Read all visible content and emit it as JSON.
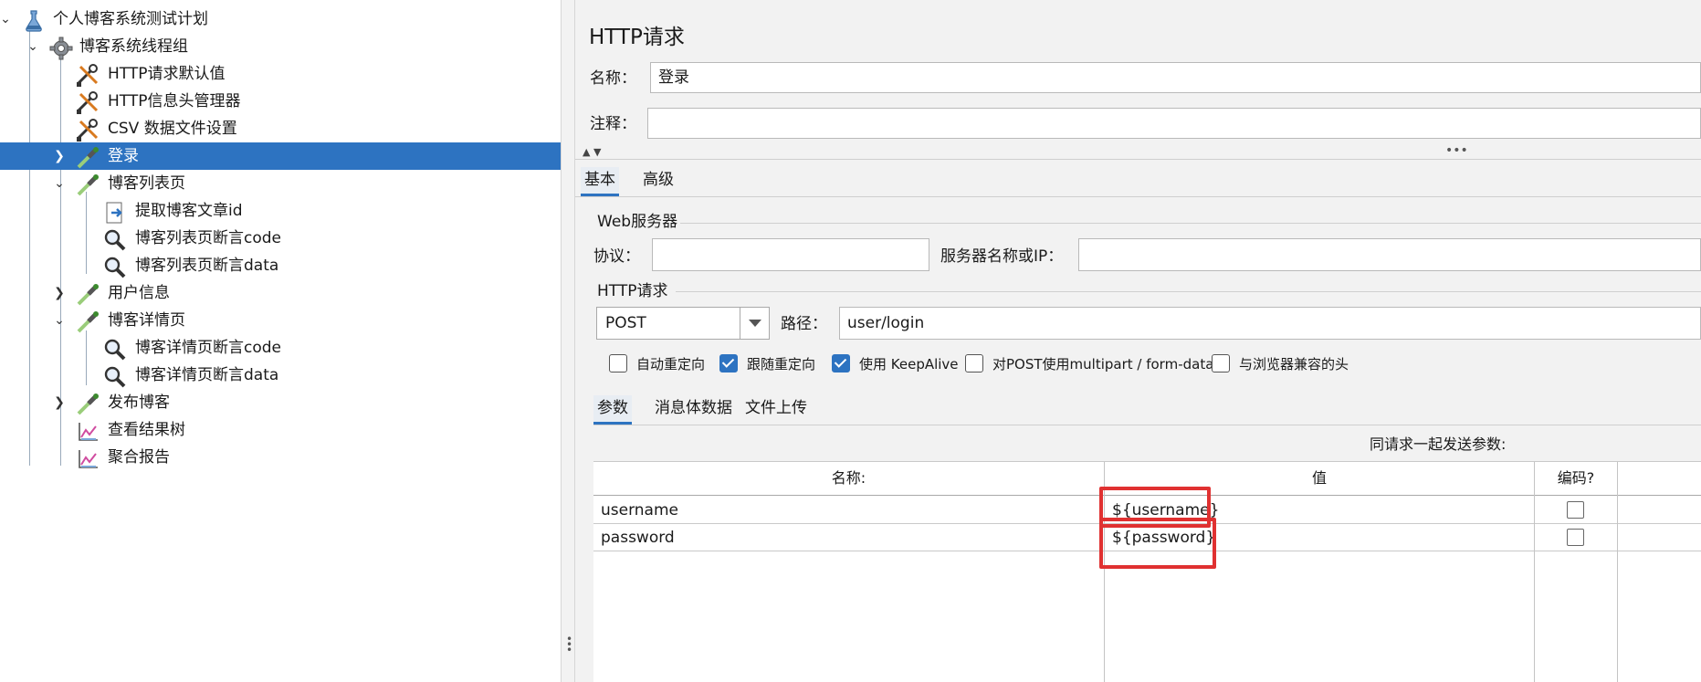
{
  "tree": {
    "items": [
      {
        "label": "个人博客系统测试计划",
        "icon": "test-plan-icon",
        "chevron": "expanded"
      },
      {
        "label": "博客系统线程组",
        "icon": "gear-icon",
        "chevron": "expanded"
      },
      {
        "label": "HTTP请求默认值",
        "icon": "wrench-icon",
        "chevron": ""
      },
      {
        "label": "HTTP信息头管理器",
        "icon": "wrench-icon",
        "chevron": ""
      },
      {
        "label": "CSV 数据文件设置",
        "icon": "wrench-icon",
        "chevron": ""
      },
      {
        "label": "登录",
        "icon": "pipette-icon",
        "chevron": "collapsed",
        "selected": true
      },
      {
        "label": "博客列表页",
        "icon": "pipette-icon",
        "chevron": "expanded"
      },
      {
        "label": "提取博客文章id",
        "icon": "extractor-icon",
        "chevron": ""
      },
      {
        "label": "博客列表页断言code",
        "icon": "magnifier-icon",
        "chevron": ""
      },
      {
        "label": "博客列表页断言data",
        "icon": "magnifier-icon",
        "chevron": ""
      },
      {
        "label": "用户信息",
        "icon": "pipette-icon",
        "chevron": "collapsed"
      },
      {
        "label": "博客详情页",
        "icon": "pipette-icon",
        "chevron": "expanded"
      },
      {
        "label": "博客详情页断言code",
        "icon": "magnifier-icon",
        "chevron": ""
      },
      {
        "label": "博客详情页断言data",
        "icon": "magnifier-icon",
        "chevron": ""
      },
      {
        "label": "发布博客",
        "icon": "pipette-icon",
        "chevron": "collapsed"
      },
      {
        "label": "查看结果树",
        "icon": "graph-icon",
        "chevron": ""
      },
      {
        "label": "聚合报告",
        "icon": "graph-icon",
        "chevron": ""
      }
    ]
  },
  "panel": {
    "title": "HTTP请求",
    "name_label": "名称：",
    "name_value": "登录",
    "comment_label": "注释：",
    "comment_value": "",
    "tabs": [
      "基本",
      "高级"
    ],
    "web_server": {
      "group_title": "Web服务器",
      "protocol_label": "协议：",
      "protocol_value": "",
      "server_label": "服务器名称或IP：",
      "server_value": ""
    },
    "http_request": {
      "group_title": "HTTP请求",
      "method": "POST",
      "path_label": "路径：",
      "path_value": "user/login"
    },
    "options": [
      {
        "label": "自动重定向",
        "checked": false
      },
      {
        "label": "跟随重定向",
        "checked": true
      },
      {
        "label": "使用 KeepAlive",
        "checked": true
      },
      {
        "label": "对POST使用multipart / form-data",
        "checked": false
      },
      {
        "label": "与浏览器兼容的头",
        "checked": false
      }
    ],
    "sub_tabs": [
      "参数",
      "消息体数据",
      "文件上传"
    ],
    "params_caption": "同请求一起发送参数:",
    "table": {
      "headers": [
        "名称:",
        "值",
        "编码?"
      ],
      "rows": [
        {
          "name": "username",
          "value": "${username}",
          "encode": false
        },
        {
          "name": "password",
          "value": "${password}",
          "encode": false
        }
      ]
    }
  },
  "colors": {
    "selection": "#2d73c1",
    "highlight_border": "#e03131",
    "panel_bg": "#f2f2f2"
  }
}
